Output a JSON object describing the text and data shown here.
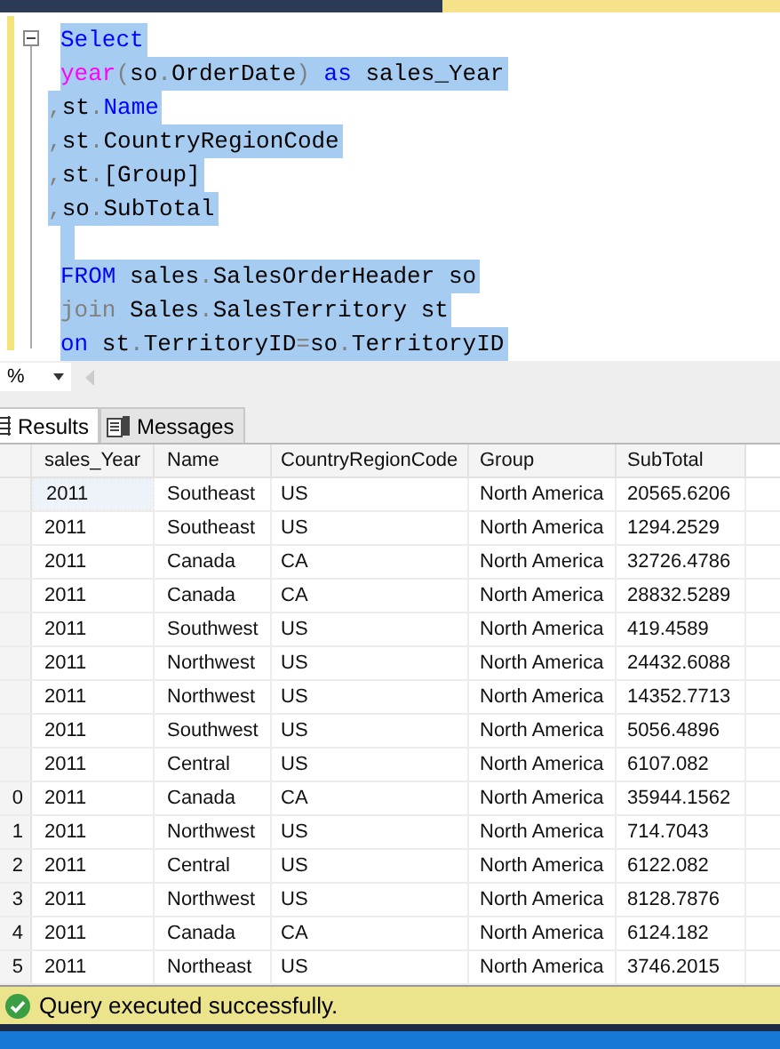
{
  "editor": {
    "lines": [
      {
        "selected": true,
        "tokens": [
          {
            "kind": "keyword",
            "text": "Select"
          }
        ]
      },
      {
        "selected": true,
        "tokens": [
          {
            "kind": "function",
            "text": "year"
          },
          {
            "kind": "operator",
            "text": "("
          },
          {
            "kind": "plain",
            "text": "so"
          },
          {
            "kind": "operator",
            "text": "."
          },
          {
            "kind": "plain",
            "text": "OrderDate"
          },
          {
            "kind": "operator",
            "text": ")"
          },
          {
            "kind": "keyword",
            "text": " as"
          },
          {
            "kind": "plain",
            "text": " sales_Year"
          }
        ]
      },
      {
        "selected": true,
        "tokens": [
          {
            "kind": "operator",
            "text": ","
          },
          {
            "kind": "plain",
            "text": "st"
          },
          {
            "kind": "operator",
            "text": "."
          },
          {
            "kind": "keyword",
            "text": "Name"
          }
        ]
      },
      {
        "selected": true,
        "tokens": [
          {
            "kind": "operator",
            "text": ","
          },
          {
            "kind": "plain",
            "text": "st"
          },
          {
            "kind": "operator",
            "text": "."
          },
          {
            "kind": "plain",
            "text": "CountryRegionCode"
          }
        ]
      },
      {
        "selected": true,
        "tokens": [
          {
            "kind": "operator",
            "text": ","
          },
          {
            "kind": "plain",
            "text": "st"
          },
          {
            "kind": "operator",
            "text": "."
          },
          {
            "kind": "plain",
            "text": "[Group]"
          }
        ]
      },
      {
        "selected": true,
        "tokens": [
          {
            "kind": "operator",
            "text": ","
          },
          {
            "kind": "plain",
            "text": "so"
          },
          {
            "kind": "operator",
            "text": "."
          },
          {
            "kind": "plain",
            "text": "SubTotal"
          }
        ]
      },
      {
        "selected": true
      },
      {
        "selected": true,
        "tokens": [
          {
            "kind": "keyword",
            "text": "FROM"
          },
          {
            "kind": "plain",
            "text": " sales"
          },
          {
            "kind": "operator",
            "text": "."
          },
          {
            "kind": "plain",
            "text": "SalesOrderHeader so"
          }
        ]
      },
      {
        "selected": true,
        "tokens": [
          {
            "kind": "operator",
            "text": "join"
          },
          {
            "kind": "plain",
            "text": " Sales"
          },
          {
            "kind": "operator",
            "text": "."
          },
          {
            "kind": "plain",
            "text": "SalesTerritory st"
          }
        ]
      },
      {
        "selected": true,
        "tokens": [
          {
            "kind": "keyword",
            "text": "on"
          },
          {
            "kind": "plain",
            "text": " st"
          },
          {
            "kind": "operator",
            "text": "."
          },
          {
            "kind": "plain",
            "text": "TerritoryID"
          },
          {
            "kind": "operator",
            "text": "="
          },
          {
            "kind": "plain",
            "text": "so"
          },
          {
            "kind": "operator",
            "text": "."
          },
          {
            "kind": "plain",
            "text": "TerritoryID"
          }
        ]
      }
    ]
  },
  "zoom": {
    "value": "%"
  },
  "result_tabs": [
    {
      "label": "Results",
      "selected": true
    },
    {
      "label": "Messages",
      "selected": false
    }
  ],
  "results": {
    "columns": [
      "sales_Year",
      "Name",
      "CountryRegionCode",
      "Group",
      "SubTotal"
    ],
    "rows": [
      {
        "cells": [
          "2011",
          "Southeast",
          "US",
          "North America",
          "20565.6206"
        ]
      },
      {
        "cells": [
          "2011",
          "Southeast",
          "US",
          "North America",
          "1294.2529"
        ]
      },
      {
        "cells": [
          "2011",
          "Canada",
          "CA",
          "North America",
          "32726.4786"
        ]
      },
      {
        "cells": [
          "2011",
          "Canada",
          "CA",
          "North America",
          "28832.5289"
        ]
      },
      {
        "cells": [
          "2011",
          "Southwest",
          "US",
          "North America",
          "419.4589"
        ]
      },
      {
        "cells": [
          "2011",
          "Northwest",
          "US",
          "North America",
          "24432.6088"
        ]
      },
      {
        "cells": [
          "2011",
          "Northwest",
          "US",
          "North America",
          "14352.7713"
        ]
      },
      {
        "cells": [
          "2011",
          "Southwest",
          "US",
          "North America",
          "5056.4896"
        ]
      },
      {
        "cells": [
          "2011",
          "Central",
          "US",
          "North America",
          "6107.082"
        ]
      },
      {
        "row_label": "0",
        "cells": [
          "2011",
          "Canada",
          "CA",
          "North America",
          "35944.1562"
        ]
      },
      {
        "row_label": "1",
        "cells": [
          "2011",
          "Northwest",
          "US",
          "North America",
          "714.7043"
        ]
      },
      {
        "row_label": "2",
        "cells": [
          "2011",
          "Central",
          "US",
          "North America",
          "6122.082"
        ]
      },
      {
        "row_label": "3",
        "cells": [
          "2011",
          "Northwest",
          "US",
          "North America",
          "8128.7876"
        ]
      },
      {
        "row_label": "4",
        "cells": [
          "2011",
          "Canada",
          "CA",
          "North America",
          "6124.182"
        ]
      },
      {
        "row_label": "5",
        "cells": [
          "2011",
          "Northeast",
          "US",
          "North America",
          "3746.2015"
        ]
      }
    ]
  },
  "status_bar": {
    "message": "Query executed successfully."
  }
}
